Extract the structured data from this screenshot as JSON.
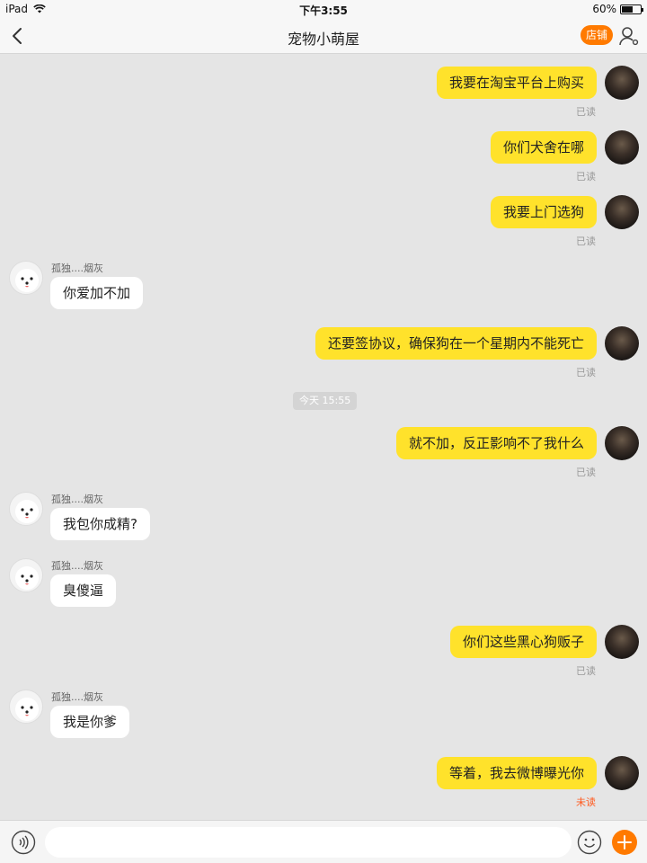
{
  "status": {
    "device": "iPad",
    "time": "下午3:55",
    "battery": "60%",
    "battery_level": 0.6
  },
  "nav": {
    "title": "宠物小萌屋",
    "shop_label": "店铺"
  },
  "messages": [
    {
      "text": "我要在淘宝平台上购买",
      "status": "已读"
    },
    {
      "text": "你们犬舍在哪",
      "status": "已读"
    },
    {
      "text": "我要上门选狗",
      "status": "已读"
    },
    {
      "sender": "孤独....烟灰",
      "text": "你爱加不加"
    },
    {
      "text": "还要签协议，确保狗在一个星期内不能死亡",
      "status": "已读"
    },
    {
      "text": "就不加，反正影响不了我什么",
      "status": "已读"
    },
    {
      "sender": "孤独....烟灰",
      "text": "我包你成精?"
    },
    {
      "sender": "孤独....烟灰",
      "text": "臭傻逼"
    },
    {
      "text": "你们这些黑心狗贩子",
      "status": "已读"
    },
    {
      "sender": "孤独....烟灰",
      "text": "我是你爹"
    },
    {
      "text": "等着，我去微博曝光你",
      "status": "未读"
    }
  ],
  "timestamp": "今天 15:55",
  "input": {
    "placeholder": ""
  },
  "colors": {
    "outgoing_bubble": "#ffe22b",
    "incoming_bubble": "#ffffff",
    "accent": "#ff7a00",
    "unread": "#ff5a1f"
  }
}
